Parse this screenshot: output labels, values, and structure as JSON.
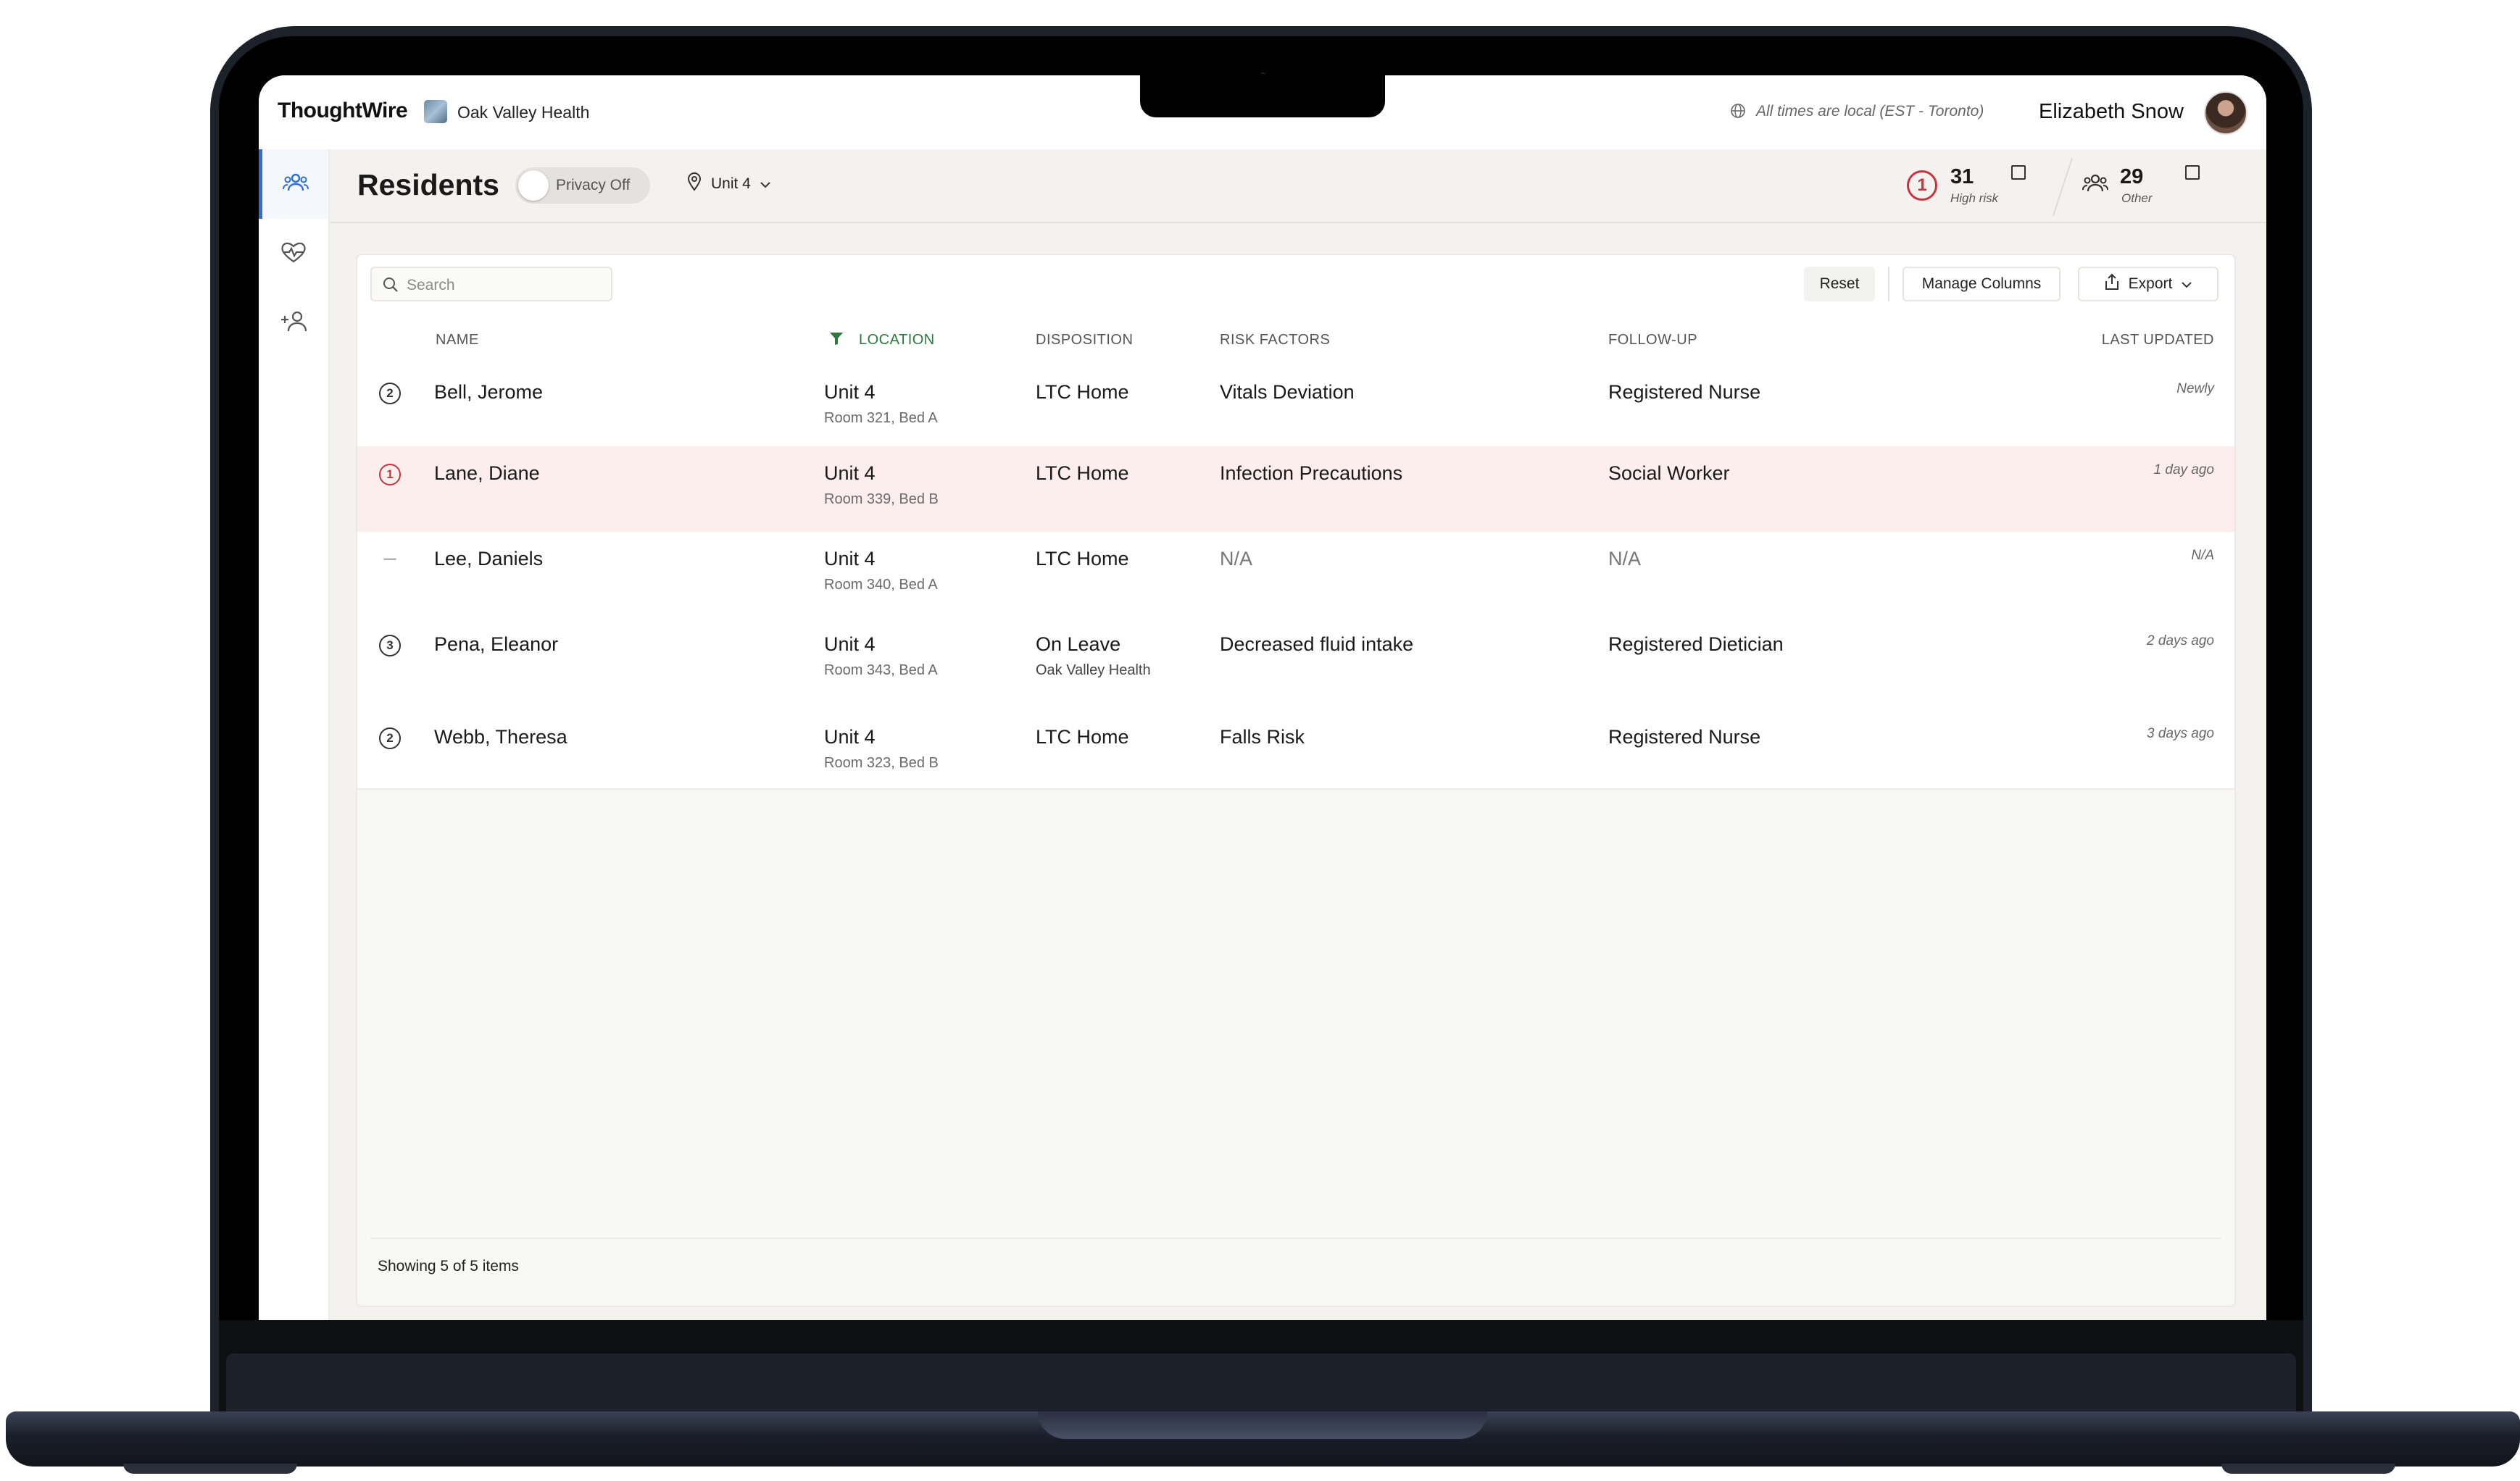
{
  "topbar": {
    "logo": "ThoughtWire",
    "org_name": "Oak Valley Health",
    "timezone_note": "All times are local (EST  - Toronto)",
    "user_name": "Elizabeth Snow"
  },
  "sidebar": {
    "items": [
      {
        "icon": "residents-icon",
        "active": true
      },
      {
        "icon": "heart-pulse-icon",
        "active": false
      },
      {
        "icon": "add-person-icon",
        "active": false
      }
    ]
  },
  "header": {
    "title": "Residents",
    "privacy_toggle_label": "Privacy Off",
    "unit_selected": "Unit 4",
    "stats": {
      "high_risk_badge": "1",
      "high_risk_count": "31",
      "high_risk_label": "High risk",
      "other_count": "29",
      "other_label": "Other"
    }
  },
  "toolbar": {
    "search_placeholder": "Search",
    "reset_label": "Reset",
    "manage_columns_label": "Manage Columns",
    "export_label": "Export"
  },
  "table": {
    "columns": [
      "NAME",
      "LOCATION",
      "DISPOSITION",
      "RISK FACTORS",
      "FOLLOW-UP",
      "LAST UPDATED"
    ],
    "rows": [
      {
        "risk": "2",
        "name": "Bell, Jerome",
        "unit": "Unit 4",
        "room": "Room 321, Bed A",
        "disposition": "LTC Home",
        "disposition_sub": "",
        "risk_factors": "Vitals Deviation",
        "follow_up": "Registered Nurse",
        "updated": "Newly"
      },
      {
        "risk": "1",
        "name": "Lane, Diane",
        "unit": "Unit 4",
        "room": "Room 339, Bed B",
        "disposition": "LTC Home",
        "disposition_sub": "",
        "risk_factors": "Infection Precautions",
        "follow_up": "Social Worker",
        "updated": "1 day ago"
      },
      {
        "risk": "—",
        "name": "Lee, Daniels",
        "unit": "Unit 4",
        "room": "Room 340, Bed A",
        "disposition": "LTC Home",
        "disposition_sub": "",
        "risk_factors": "N/A",
        "follow_up": "N/A",
        "updated": "N/A"
      },
      {
        "risk": "3",
        "name": "Pena, Eleanor",
        "unit": "Unit 4",
        "room": "Room 343, Bed A",
        "disposition": "On Leave",
        "disposition_sub": "Oak Valley Health",
        "risk_factors": "Decreased fluid intake",
        "follow_up": "Registered Dietician",
        "updated": "2 days ago"
      },
      {
        "risk": "2",
        "name": "Webb, Theresa",
        "unit": "Unit 4",
        "room": "Room 323, Bed B",
        "disposition": "LTC Home",
        "disposition_sub": "",
        "risk_factors": "Falls Risk",
        "follow_up": "Registered Nurse",
        "updated": "3 days ago"
      }
    ],
    "footer": "Showing 5 of 5 items"
  },
  "colors": {
    "accent_blue": "#2f6fd1",
    "filter_green": "#2b7a3d",
    "high_risk_red": "#c8343c",
    "high_risk_row": "#fdeeee"
  }
}
